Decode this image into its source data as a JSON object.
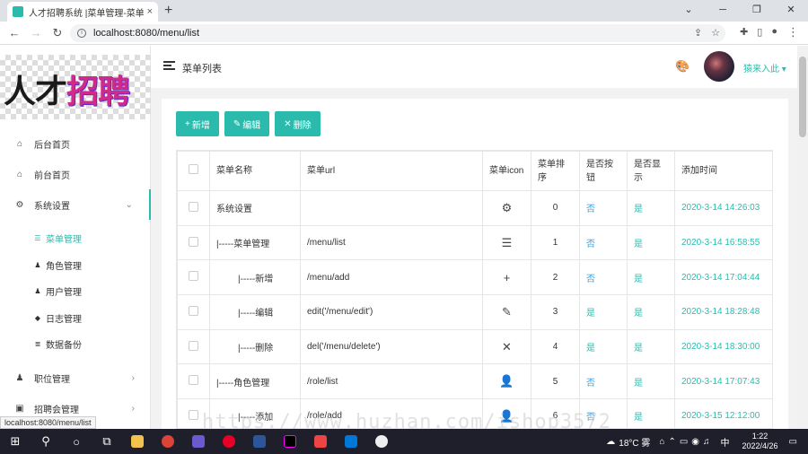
{
  "browser": {
    "tab_title": "人才招聘系统 |菜单管理-菜单列",
    "tab_close": "×",
    "new_tab": "+",
    "url": "localhost:8080/menu/list",
    "status_url": "localhost:8080/menu/list",
    "win_min": "─",
    "win_max": "❐",
    "win_close": "✕"
  },
  "sidebar": {
    "logo": {
      "part1": "人才",
      "part2": "招聘"
    },
    "items": [
      {
        "label": "后台首页",
        "icon": "home-icon"
      },
      {
        "label": "前台首页",
        "icon": "home-icon"
      },
      {
        "label": "系统设置",
        "icon": "gear-icon",
        "open": true
      }
    ],
    "subitems": [
      {
        "label": "菜单管理",
        "icon": "list-icon",
        "active": true
      },
      {
        "label": "角色管理",
        "icon": "user-cog-icon"
      },
      {
        "label": "用户管理",
        "icon": "users-icon"
      },
      {
        "label": "日志管理",
        "icon": "tag-icon"
      },
      {
        "label": "数据备份",
        "icon": "database-icon"
      }
    ],
    "bottom_items": [
      {
        "label": "职位管理",
        "icon": "users-icon"
      },
      {
        "label": "招聘会管理",
        "icon": "briefcase-icon"
      }
    ]
  },
  "header": {
    "page_title": "菜单列表",
    "username": "猿来入此"
  },
  "toolbar": {
    "add_label": "新增",
    "edit_label": "编辑",
    "delete_label": "删除"
  },
  "table": {
    "headers": {
      "name": "菜单名称",
      "url": "菜单url",
      "icon": "菜单icon",
      "sort": "菜单排序",
      "is_button": "是否按钮",
      "is_show": "是否显示",
      "time": "添加时间"
    },
    "rows": [
      {
        "name": "系统设置",
        "url": "",
        "icon": "gear-icon",
        "glyph": "⚙",
        "sort": "0",
        "is_button": "否",
        "is_show": "是",
        "time": "2020-3-14 14:26:03"
      },
      {
        "name": "|-----菜单管理",
        "url": "/menu/list",
        "icon": "list-icon",
        "glyph": "☰",
        "sort": "1",
        "is_button": "否",
        "is_show": "是",
        "time": "2020-3-14 16:58:55"
      },
      {
        "name": "|-----新增",
        "url": "/menu/add",
        "icon": "plus-icon",
        "glyph": "+",
        "sort": "2",
        "is_button": "否",
        "is_show": "是",
        "time": "2020-3-14 17:04:44"
      },
      {
        "name": "|-----编辑",
        "url": "edit('/menu/edit')",
        "icon": "pencil-icon",
        "glyph": "✎",
        "sort": "3",
        "is_button": "是",
        "is_show": "是",
        "time": "2020-3-14 18:28:48"
      },
      {
        "name": "|-----删除",
        "url": "del('/menu/delete')",
        "icon": "close-icon",
        "glyph": "✕",
        "sort": "4",
        "is_button": "是",
        "is_show": "是",
        "time": "2020-3-14 18:30:00"
      },
      {
        "name": "|-----角色管理",
        "url": "/role/list",
        "icon": "user-cog-icon",
        "glyph": "👤",
        "sort": "5",
        "is_button": "否",
        "is_show": "是",
        "time": "2020-3-14 17:07:43"
      },
      {
        "name": "|-----添加",
        "url": "/role/add",
        "icon": "user-plus-icon",
        "glyph": "👤",
        "sort": "6",
        "is_button": "否",
        "is_show": "是",
        "time": "2020-3-15 12:12:00"
      }
    ]
  },
  "taskbar": {
    "weather": "18°C 雾",
    "time": "1:22",
    "date": "2022/4/26",
    "ime": "中"
  },
  "watermark": "https://www.huzhan.com/ishop3572",
  "colors": {
    "accent": "#2bbbad",
    "link_no": "#3aa0d8"
  }
}
